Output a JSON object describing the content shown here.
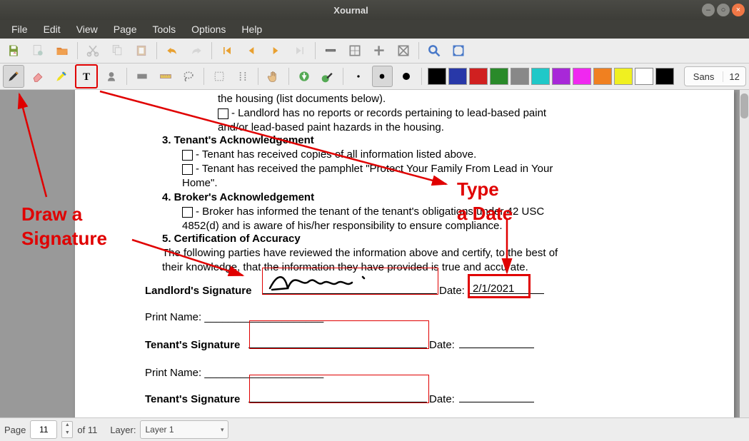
{
  "app_title": "Xournal",
  "menus": [
    "File",
    "Edit",
    "View",
    "Page",
    "Tools",
    "Options",
    "Help"
  ],
  "font_name": "Sans",
  "font_size": "12",
  "status": {
    "page_label": "Page",
    "page_num": "11",
    "page_total": "of 11",
    "layer_label": "Layer:",
    "layer_value": "Layer 1"
  },
  "doc": {
    "line0": "the housing (list documents below).",
    "line1a": "- Landlord has no reports or records pertaining to lead-based paint",
    "line1b": "and/or lead-based paint hazards in the housing.",
    "h3": "3.   Tenant's Acknowledgement",
    "l3a": "- Tenant has received copies of all information listed above.",
    "l3b": "- Tenant has received the pamphlet \"Protect Your Family From Lead in Your",
    "l3c": "Home\".",
    "h4": "4.   Broker's Acknowledgement",
    "l4a": "- Broker has informed the tenant of the tenant's obligations under 42 USC",
    "l4b": "4852(d) and is aware of his/her responsibility to ensure compliance.",
    "h5": "5.   Certification of Accuracy",
    "l5a": "The following parties have reviewed the information above and certify, to the best of",
    "l5b": "their knowledge, that the information they have provided is true and accurate.",
    "landlord_sig": "Landlord's Signature",
    "date_lbl": "Date:",
    "date_val": "2/1/2021",
    "print_name": "Print Name: ____________________",
    "tenant_sig": "Tenant's Signature",
    "line_blank": "______________________"
  },
  "annot": {
    "draw1": "Draw a",
    "draw2": "Signature",
    "type1": "Type",
    "type2": "a Date"
  },
  "colors": [
    "#000000",
    "#2838a8",
    "#d02020",
    "#2a8a2a",
    "#888888",
    "#20c8c8",
    "#a828d8",
    "#f028f0",
    "#f08020",
    "#f0f020",
    "#ffffff",
    "#000000"
  ]
}
